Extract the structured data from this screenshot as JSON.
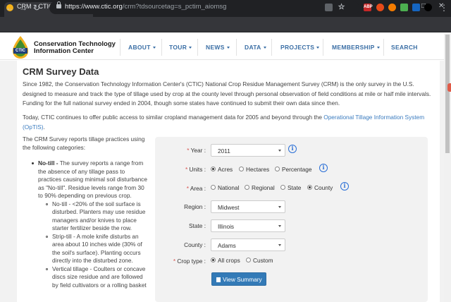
{
  "browser": {
    "tab_title": "CRM :: CTIC",
    "tab_close": "×",
    "new_tab": "+",
    "url_main": "https://www.ctic.org",
    "url_path": "/crm?tdsourcetag=s_pctim_aiomsg",
    "ext_adp": "ABP",
    "window_minimize": "–",
    "window_maximize": "□",
    "window_close": "✕",
    "back": "←",
    "forward": "→",
    "reload": "↻",
    "menu": "⋮"
  },
  "logo": {
    "short": "CTIC",
    "line1": "Conservation Technology",
    "line2": "Information Center"
  },
  "nav": {
    "about": "ABOUT",
    "tour": "TOUR",
    "news": "NEWS",
    "data": "DATA",
    "projects": "PROJECTS",
    "membership": "MEMBERSHIP",
    "search": "SEARCH"
  },
  "page": {
    "title": "CRM Survey Data",
    "para1": "Since 1982, the Conservation Technology Information Center's (CTIC) National Crop Residue Management Survey (CRM) is the only survey in the U.S. designed to measure and track the type of tillage used by crop at the county level through personal observation of field conditions at mile or half mile intervals. Funding for the full national survey ended in 2004, though some states have continued to submit their own data since then.",
    "para2_text": "Today, CTIC continues to offer public access to similar cropland management data for 2005 and beyond through the ",
    "para2_link": "Operational Tillage Information System (OpTIS)",
    "para2_end": "."
  },
  "left": {
    "intro": "The CRM Survey reports tillage practices using the following categories:",
    "notill_head": "No-till -",
    "notill_text": " The survey reports a range from the absence of any tillage pass to practices causing minimal soil disturbance as \"No-till\". Residue levels range from 30 to 90% depending on previous crop.",
    "sub1": "No-till -  <20% of the soil surface is disturbed. Planters may use residue managers and/or knives to place starter fertilizer beside the row.",
    "sub2": "Strip-till - A mole knife disturbs an area about 10 inches wide (30% of the soil's surface). Planting occurs directly into the disturbed zone.",
    "sub3": "Vertical tillage - Coulters or concave discs size residue and are followed by field cultivators or a rolling basket"
  },
  "form": {
    "year_label": "Year :",
    "year_value": "2011",
    "units_label": "Units :",
    "units_options": [
      "Acres",
      "Hectares",
      "Percentage"
    ],
    "area_label": "Area :",
    "area_options": [
      "National",
      "Regional",
      "State",
      "County"
    ],
    "region_label": "Region :",
    "region_value": "Midwest",
    "state_label": "State :",
    "state_value": "Illinois",
    "county_label": "County :",
    "county_value": "Adams",
    "crop_label": "Crop type :",
    "crop_options": [
      "All crops",
      "Custom"
    ],
    "required_mark": "*",
    "info_glyph": "i",
    "submit": "View Summary"
  }
}
